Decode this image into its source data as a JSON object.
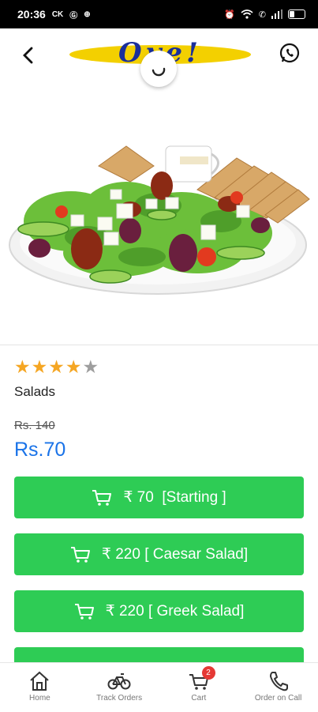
{
  "status_bar": {
    "time": "20:36",
    "icons_left": [
      "ck-icon",
      "g-icon",
      "compass-icon"
    ],
    "icons_right": [
      "alarm-icon",
      "wifi-icon",
      "call-icon",
      "signal-icon"
    ],
    "battery": "7"
  },
  "header": {
    "logo_text": "Oye!",
    "logo_colors": {
      "yellow": "#f3d000",
      "blue": "#1a2f9a"
    }
  },
  "product": {
    "image_alt": "Salad platter",
    "rating": 4,
    "rating_max": 5,
    "title": "Salads",
    "old_price": "Rs. 140",
    "price": "Rs.70",
    "variants": [
      {
        "label": "₹ 70  [Starting ]"
      },
      {
        "label": "₹ 220 [ Caesar Salad]"
      },
      {
        "label": "₹ 220 [ Greek Salad]"
      }
    ]
  },
  "bottom_nav": {
    "items": [
      {
        "label": "Home",
        "icon": "home-icon"
      },
      {
        "label": "Track Orders",
        "icon": "bicycle-icon"
      },
      {
        "label": "Cart",
        "icon": "cart-icon",
        "badge": "2"
      },
      {
        "label": "Order on Call",
        "icon": "phone-icon"
      }
    ]
  },
  "colors": {
    "accent_green": "#2ecc55",
    "price_blue": "#1a73e8",
    "star_gold": "#f5a623",
    "star_grey": "#9e9e9e"
  }
}
